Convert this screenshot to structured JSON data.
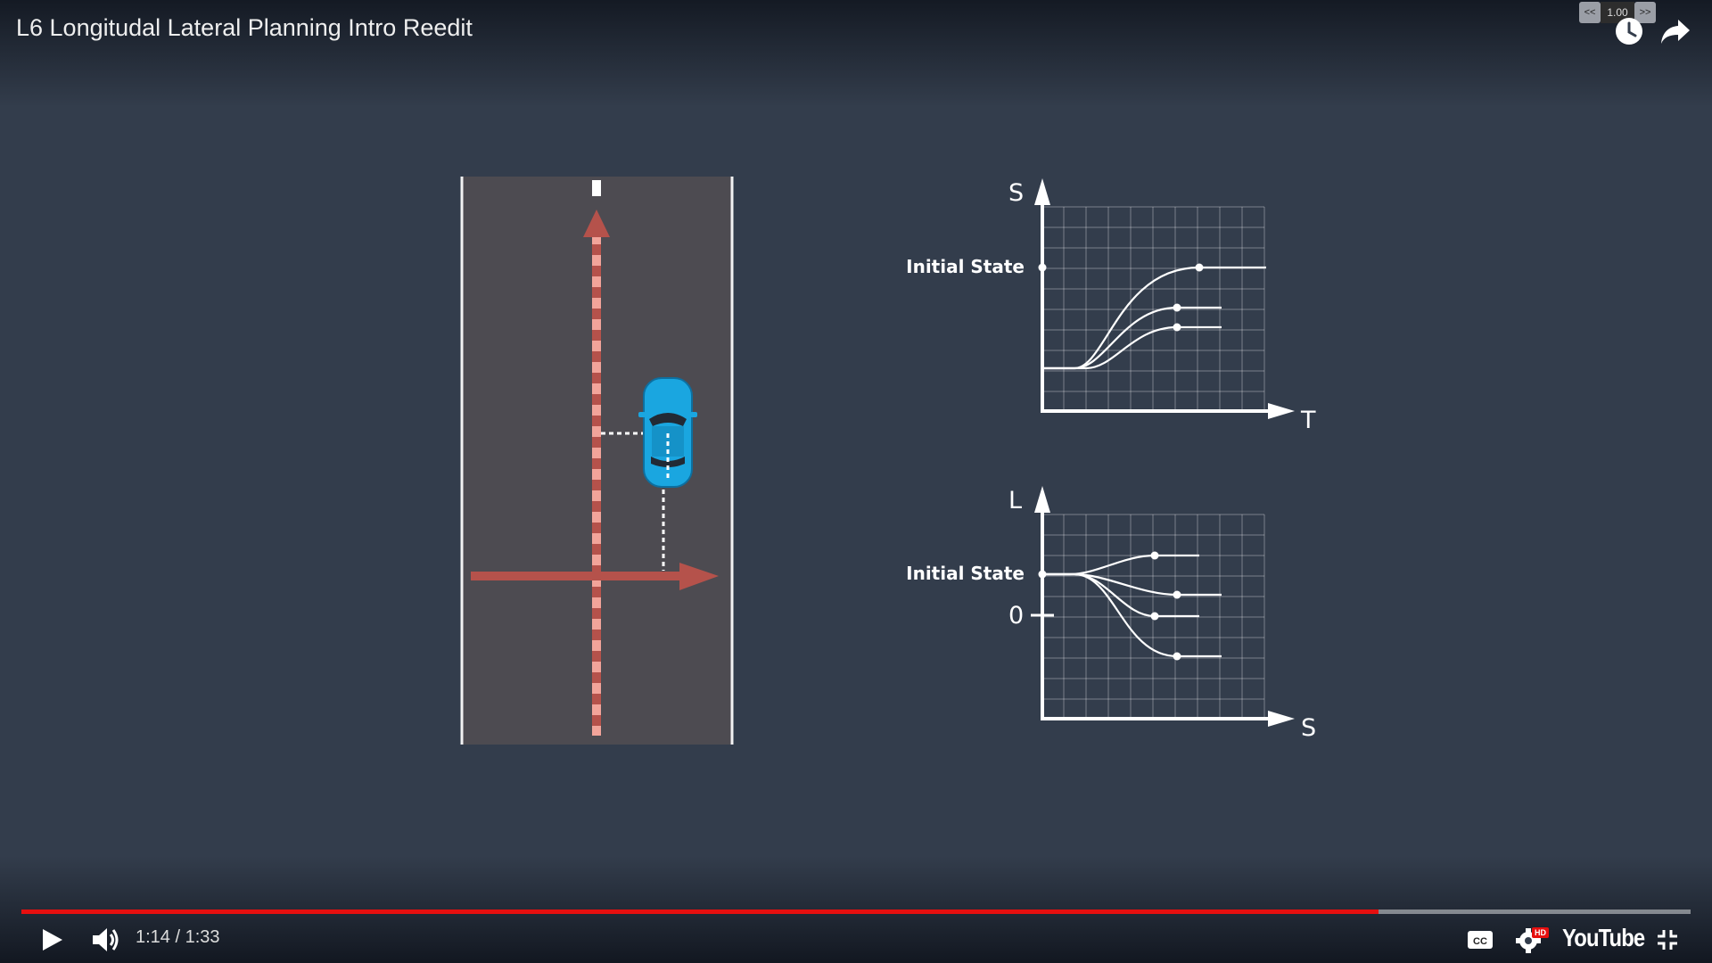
{
  "video": {
    "title": "L6 Longitudal Lateral Planning Intro Reedit"
  },
  "speed": {
    "slower_label": "<<",
    "value": "1.00",
    "faster_label": ">>"
  },
  "diagram": {
    "st_graph": {
      "y_axis_label": "S",
      "x_axis_label": "T",
      "initial_state_label": "Initial State"
    },
    "ls_graph": {
      "y_axis_label": "L",
      "x_axis_label": "S",
      "initial_state_label": "Initial State",
      "zero_label": "0"
    }
  },
  "player": {
    "time_display": "1:14 / 1:33",
    "progress": 0.813,
    "logo": "YouTube",
    "hd_badge": "HD"
  },
  "colors": {
    "background": "#333d4c",
    "road": "#4d4b51",
    "arrow": "#b5524b",
    "dash": "#f2a49a",
    "car": "#1aa6e0",
    "progress": "#e60f0f"
  }
}
